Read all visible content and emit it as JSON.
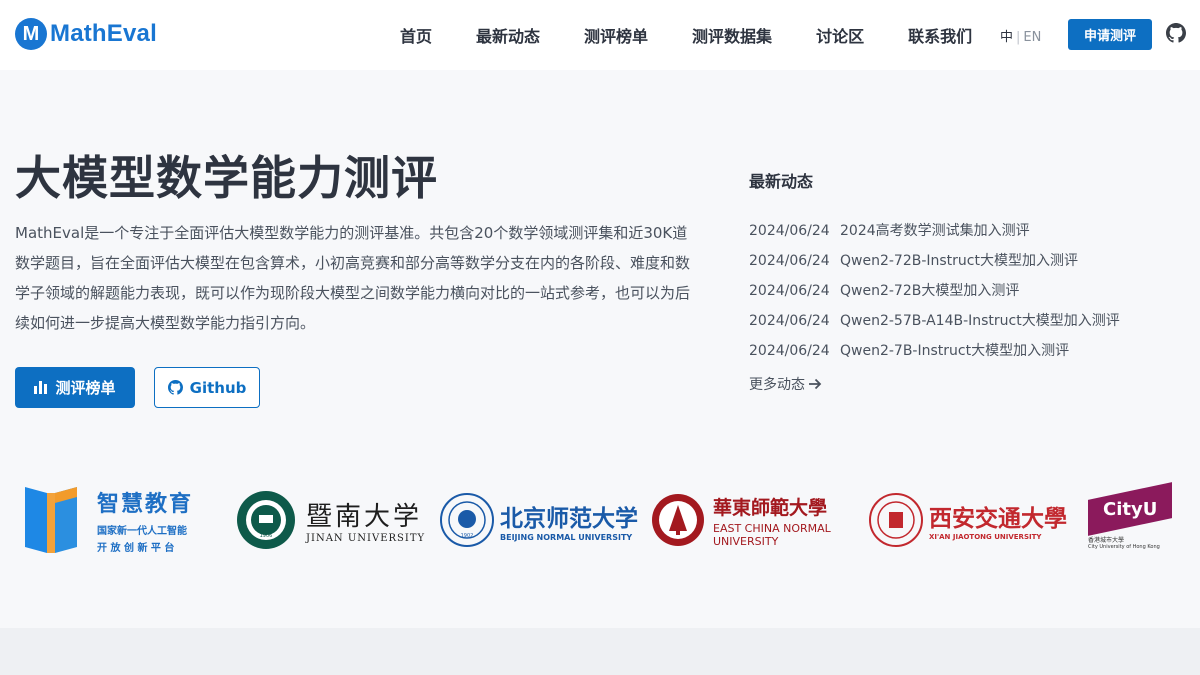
{
  "brand": {
    "logo_letter": "M",
    "name": "MathEval"
  },
  "nav": [
    {
      "label": "首页"
    },
    {
      "label": "最新动态"
    },
    {
      "label": "测评榜单"
    },
    {
      "label": "测评数据集"
    },
    {
      "label": "讨论区"
    },
    {
      "label": "联系我们"
    }
  ],
  "lang": {
    "zh": "中",
    "sep": "|",
    "en": "EN"
  },
  "header_button": "申请测评",
  "hero": {
    "title": "大模型数学能力测评",
    "description": "MathEval是一个专注于全面评估大模型数学能力的测评基准。共包含20个数学领域测评集和近30K道数学题目，旨在全面评估大模型在包含算术，小初高竞赛和部分高等数学分支在内的各阶段、难度和数学子领域的解题能力表现，既可以作为现阶段大模型之间数学能力横向对比的一站式参考，也可以为后续如何进一步提高大模型数学能力指引方向。",
    "primary_button": "测评榜单",
    "secondary_button": "Github"
  },
  "news": {
    "title": "最新动态",
    "items": [
      {
        "date": "2024/06/24",
        "text": "2024高考数学测试集加入测评"
      },
      {
        "date": "2024/06/24",
        "text": "Qwen2-72B-Instruct大模型加入测评"
      },
      {
        "date": "2024/06/24",
        "text": "Qwen2-72B大模型加入测评"
      },
      {
        "date": "2024/06/24",
        "text": "Qwen2-57B-A14B-Instruct大模型加入测评"
      },
      {
        "date": "2024/06/24",
        "text": "Qwen2-7B-Instruct大模型加入测评"
      }
    ],
    "more": "更多动态"
  },
  "partners": {
    "zhihui": {
      "name": "智慧教育",
      "line1": "国家新一代人工智能",
      "line2": "开 放 创 新 平 台"
    },
    "jinan": {
      "name": "暨南大学",
      "en": "JINAN UNIVERSITY",
      "seal_year": "1906"
    },
    "bnu": {
      "name": "北京师范大学",
      "en": "BEIJING NORMAL UNIVERSITY",
      "seal_year": "1902"
    },
    "ecnu": {
      "name": "華東師範大學",
      "en1": "EAST CHINA NORMAL",
      "en2": "UNIVERSITY"
    },
    "xjtu": {
      "name": "西安交通大學",
      "en": "XI'AN JIAOTONG UNIVERSITY"
    },
    "cityu": {
      "mark": "CityU",
      "zh": "香港城市大學",
      "en": "City University of Hong Kong"
    }
  },
  "colors": {
    "primary": "#0d6fc2",
    "brand": "#1976d2",
    "text": "#2e3440",
    "ecnu_red": "#a3191f",
    "cityu_purple": "#8b1a5c"
  }
}
